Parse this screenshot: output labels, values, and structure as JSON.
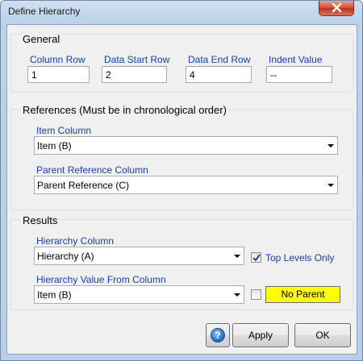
{
  "window": {
    "title": "Define Hierarchy"
  },
  "general": {
    "label": "General",
    "column_row": {
      "label": "Column Row",
      "value": "1"
    },
    "data_start_row": {
      "label": "Data Start Row",
      "value": "2"
    },
    "data_end_row": {
      "label": "Data End Row",
      "value": "4"
    },
    "indent_value": {
      "label": "Indent Value",
      "value": "--"
    }
  },
  "references": {
    "label": "References (Must be in chronological order)",
    "item_column": {
      "label": "Item Column",
      "value": "Item (B)"
    },
    "parent_reference_column": {
      "label": "Parent Reference Column",
      "value": "Parent Reference (C)"
    }
  },
  "results": {
    "label": "Results",
    "hierarchy_column": {
      "label": "Hierarchy Column",
      "value": "Hierarchy (A)"
    },
    "top_levels_only": {
      "label": "Top Levels Only",
      "checked": true
    },
    "hierarchy_value_from_column": {
      "label": "Hierarchy Value From Column",
      "value": "Item (B)"
    },
    "no_parent": {
      "checked": false,
      "badge": "No Parent",
      "badge_color": "#ffff00"
    }
  },
  "buttons": {
    "help_glyph": "?",
    "apply": "Apply",
    "ok": "OK"
  },
  "icons": {
    "close": "close-icon",
    "help": "help-icon",
    "dropdown": "chevron-down-icon",
    "check": "check-icon"
  }
}
